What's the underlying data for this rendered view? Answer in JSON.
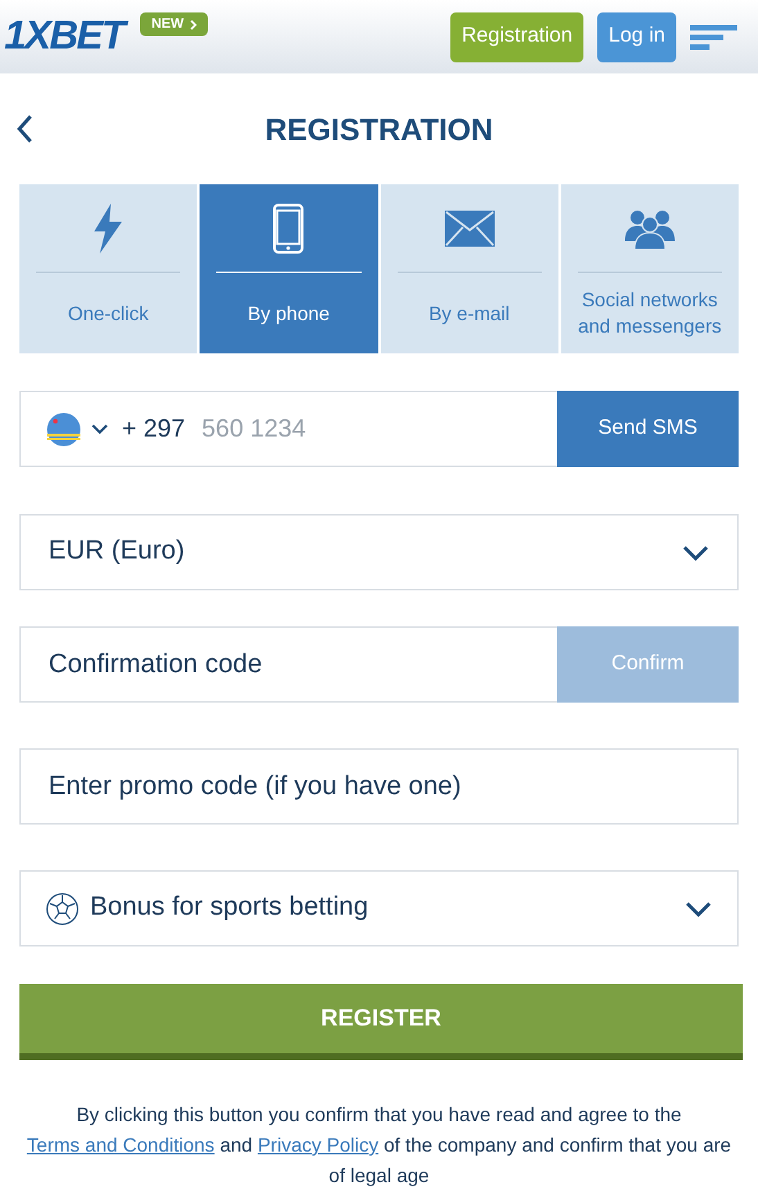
{
  "header": {
    "logo": "1XBET",
    "new_badge": "NEW",
    "buttons": [
      {
        "kind": "register",
        "label": "Registration"
      },
      {
        "kind": "login",
        "label": "Log in"
      }
    ]
  },
  "title": "REGISTRATION",
  "tabs": [
    {
      "kind": "bolt",
      "label": "One-click",
      "selected": false
    },
    {
      "kind": "phone",
      "label": "By phone",
      "selected": true
    },
    {
      "kind": "mail",
      "label": "By e-mail",
      "selected": false
    },
    {
      "kind": "people",
      "label": "Social networks and messengers",
      "selected": false
    }
  ],
  "phone": {
    "code": "+ 297",
    "placeholder": "560 1234",
    "button": "Send SMS"
  },
  "currency": {
    "value": "EUR (Euro)"
  },
  "confirmation": {
    "placeholder": "Confirmation code",
    "button": "Confirm",
    "disabled": true
  },
  "promo": {
    "placeholder": "Enter promo code (if you have one)"
  },
  "bonus": {
    "value": "Bonus for sports betting"
  },
  "register_button": "REGISTER",
  "legal": [
    {
      "kind": "text",
      "text": "By clicking this button you confirm that you have read and agree to the "
    },
    {
      "kind": "link",
      "text": "Terms and Conditions"
    },
    {
      "kind": "text",
      "text": " and "
    },
    {
      "kind": "link",
      "text": "Privacy Policy"
    },
    {
      "kind": "text",
      "text": " of the company and confirm that you are of legal age"
    }
  ]
}
